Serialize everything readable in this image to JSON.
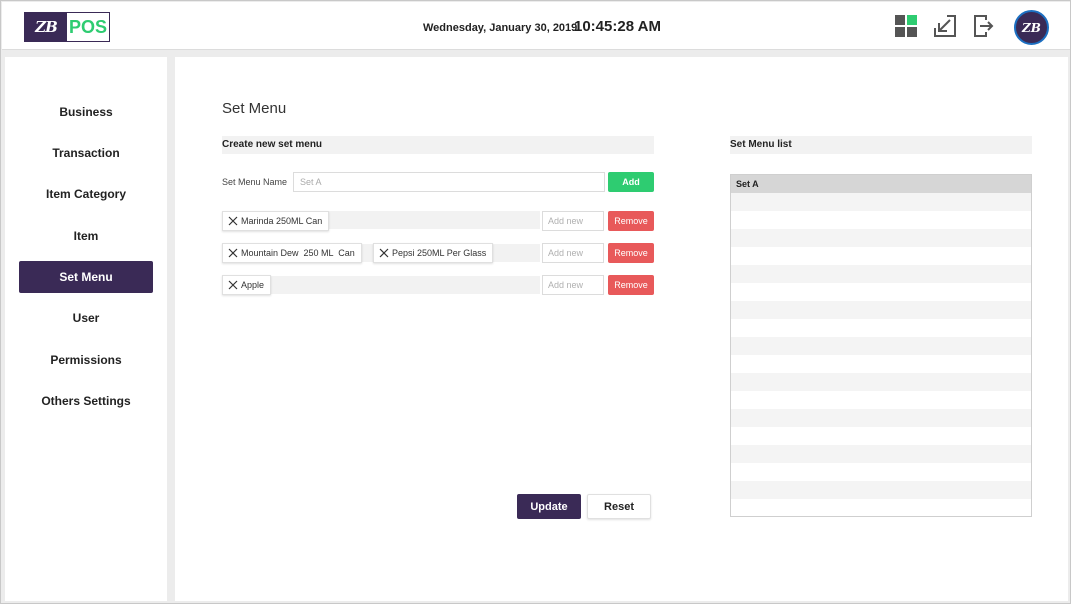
{
  "header": {
    "logo_mark": "ZB",
    "logo_text": "POS",
    "date": "Wednesday, January 30, 2019",
    "time": "10:45:28 AM",
    "icons": [
      "dashboard-grid-icon",
      "minimize-arrow-icon",
      "logout-icon"
    ],
    "avatar_text": "ZB",
    "colors": {
      "brand_purple": "#3a2a56",
      "brand_green": "#2ecc71"
    }
  },
  "sidebar": {
    "items": [
      {
        "label": "Business"
      },
      {
        "label": "Transaction"
      },
      {
        "label": "Item Category"
      },
      {
        "label": "Item"
      },
      {
        "label": "Set Menu",
        "active": true
      },
      {
        "label": "User"
      },
      {
        "label": "Permissions"
      },
      {
        "label": "Others Settings"
      }
    ]
  },
  "main": {
    "title": "Set Menu",
    "create_section": "Create new set menu",
    "name_label": "Set Menu Name",
    "name_value": "Set A",
    "add_label": "Add",
    "groups": [
      {
        "chips": [
          "Marinda 250ML Can"
        ],
        "add_placeholder": "Add new",
        "remove_label": "Remove"
      },
      {
        "chips": [
          "Mountain Dew  250 ML  Can",
          "Pepsi 250ML Per Glass"
        ],
        "add_placeholder": "Add new",
        "remove_label": "Remove"
      },
      {
        "chips": [
          "Apple"
        ],
        "add_placeholder": "Add new",
        "remove_label": "Remove"
      }
    ],
    "update_label": "Update",
    "reset_label": "Reset",
    "remove_color": "#e8595a"
  },
  "list": {
    "title": "Set Menu list",
    "header": "Set A"
  }
}
